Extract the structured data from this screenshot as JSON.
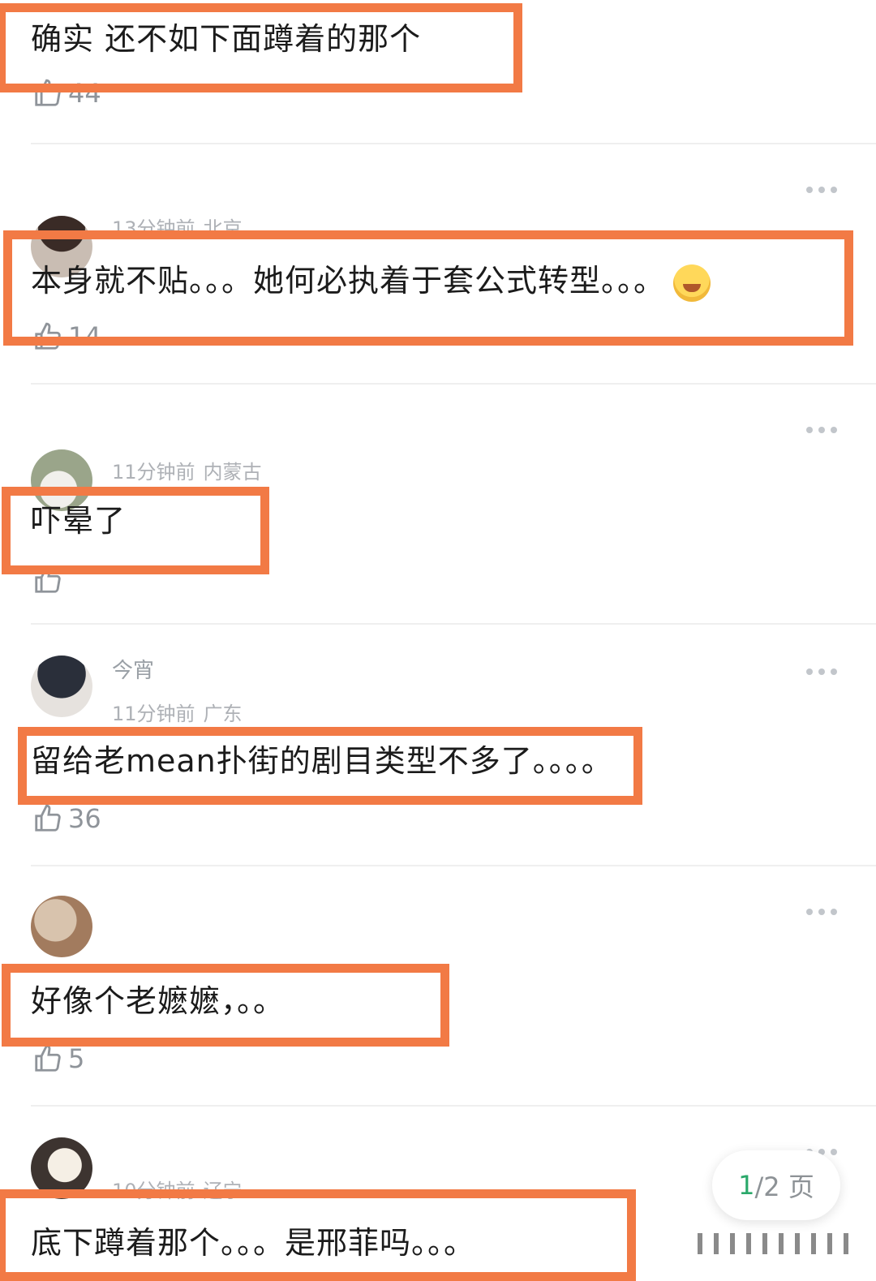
{
  "comments": [
    {
      "text": "确实 还不如下面蹲着的那个",
      "likes": "44",
      "meta": ""
    },
    {
      "text": "本身就不贴。。。她何必执着于套公式转型。。。",
      "likes": "14",
      "time": "13分钟前",
      "location": "北京",
      "emoji": "laughing-tears-emoji"
    },
    {
      "text": "吓晕了",
      "likes": "",
      "time": "11分钟前",
      "location": "内蒙古"
    },
    {
      "text": "留给老mean扑街的剧目类型不多了。。。。",
      "likes": "36",
      "time": "11分钟前",
      "location": "广东",
      "user": "今宵"
    },
    {
      "text": "好像个老嬷嬷，。。",
      "likes": "5",
      "time": "",
      "location": ""
    },
    {
      "text": "底下蹲着那个。。。是邢菲吗。。。",
      "likes": "",
      "time": "10分钟前",
      "location": "辽宁"
    }
  ],
  "pager": {
    "current": "1",
    "rest": "/2 页"
  },
  "colors": {
    "highlight": "#f27a45",
    "pager_current": "#2aa86a"
  }
}
